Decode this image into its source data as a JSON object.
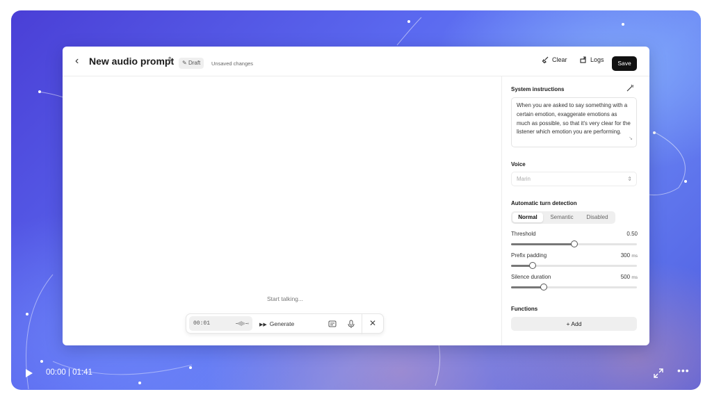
{
  "editor": {
    "title": "New audio prompt",
    "status_badge": "Draft",
    "unsaved_text": "Unsaved changes",
    "clear_label": "Clear",
    "logs_label": "Logs",
    "save_label": "Save"
  },
  "canvas": {
    "status_text": "Start talking...",
    "timer": "00:01",
    "generate_label": "Generate"
  },
  "panel": {
    "system_instructions_label": "System instructions",
    "system_instructions_text": "When you are asked to say something with a certain emotion, exaggerate emotions as much as possible, so that it's very clear for the listener which emotion you are performing.",
    "voice_label": "Voice",
    "voice_value": "Marin",
    "turn_detection_label": "Automatic turn detection",
    "turn_modes": [
      "Normal",
      "Semantic",
      "Disabled"
    ],
    "turn_mode_selected": "Normal",
    "threshold_label": "Threshold",
    "threshold_value": "0.50",
    "threshold_fraction": 0.5,
    "prefix_label": "Prefix padding",
    "prefix_value": "300",
    "prefix_unit": "ms",
    "prefix_fraction": 0.17,
    "silence_label": "Silence duration",
    "silence_value": "500",
    "silence_unit": "ms",
    "silence_fraction": 0.26,
    "functions_label": "Functions",
    "add_label": "Add"
  },
  "player": {
    "time_display": "00:00 | 01:41"
  },
  "icons": [
    "back-chevron-icon",
    "title-caret-icon",
    "draft-icon",
    "broom-icon",
    "logs-icon",
    "generate-icon",
    "captions-icon",
    "microphone-icon",
    "close-icon",
    "magic-wand-icon",
    "select-caret-icon",
    "plus-icon",
    "play-icon",
    "expand-icon",
    "more-icon"
  ]
}
